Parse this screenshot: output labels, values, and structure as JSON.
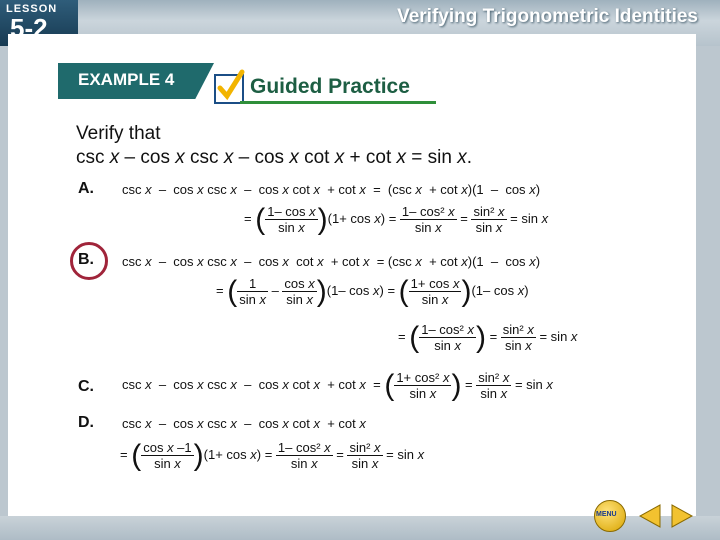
{
  "header": {
    "lesson_word": "LESSON",
    "lesson_number": "5-2",
    "title": "Verifying Trigonometric Identities"
  },
  "example": {
    "label": "EXAMPLE 4",
    "guided_practice": "Guided Practice"
  },
  "problem": {
    "line1": "Verify that",
    "line2": "csc x – cos x csc x – cos x cot x + cot x = sin x."
  },
  "choices": [
    {
      "label": "A.",
      "line1": "csc x  –  cos x csc x  –  cos x cot x  + cot x  =  (csc x  + cot x)(1  –  cos x)",
      "line2": "=  ( 1–cos x / sin x )(1+cos x)  =  1–cos² x / sin x  =  sin² x / sin x  = sin x"
    },
    {
      "label": "B.",
      "line1": "csc x  –  cos x csc x  –  cos x cot x  + cot x  = (csc x  + cot x)(1  –  cos x)",
      "line2": "=  ( 1/sin x – cos x/sin x )(1–cos x)  =  ( 1+cos x / sin x )(1–cos x)",
      "line3": "=  ( 1–cos² x / sin x )  =  sin² x / sin x  = sin x"
    },
    {
      "label": "C.",
      "line1": "csc x  –  cos x csc x  –  cos x cot x  + cot x  =  ( 1+cos² x / sin x )  =  sin² x / sin x  = sin x"
    },
    {
      "label": "D.",
      "line1": "csc x  –  cos x csc x  –  cos x cot x  + cot x",
      "line2": "= ( cos x –1 / sin x )(1+cos x)  =  1–cos² x / sin x  =  sin² x / sin x  = sin x"
    }
  ],
  "selected_choice": "B",
  "footer": {
    "menu_label": "MENU"
  },
  "colors": {
    "accent_teal": "#1f6a6c",
    "ring": "#a0243a",
    "gp_green": "#1d5e43"
  }
}
